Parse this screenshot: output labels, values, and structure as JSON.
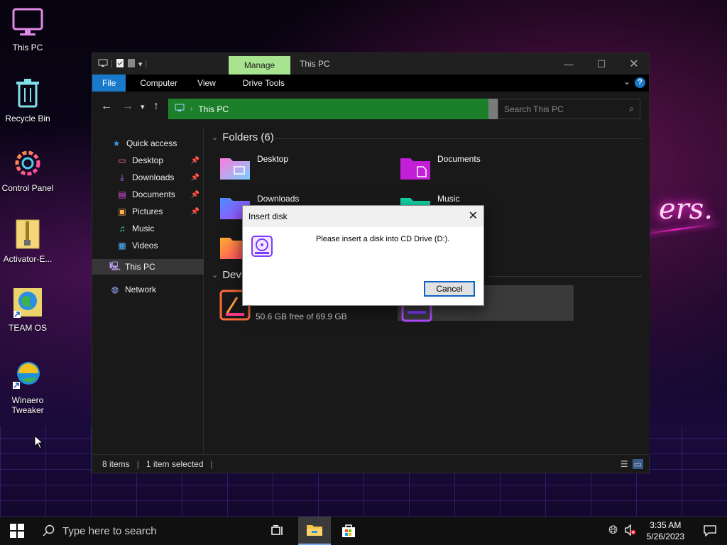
{
  "desktop": {
    "icons": [
      {
        "label": "This PC",
        "icon": "computer-icon"
      },
      {
        "label": "Recycle Bin",
        "icon": "trash-icon"
      },
      {
        "label": "Control Panel",
        "icon": "gear-icon"
      },
      {
        "label": "Activator-E...",
        "icon": "zip-folder-icon"
      },
      {
        "label": "TEAM OS",
        "icon": "globe-shortcut-icon"
      },
      {
        "label": "Winaero Tweaker",
        "line1": "Winaero",
        "line2": "Tweaker",
        "icon": "tweaker-icon"
      }
    ],
    "wallpaper_text": "ers."
  },
  "explorer": {
    "title": "This PC",
    "manage_tab": "Manage",
    "ribbon_tabs": [
      "File",
      "Computer",
      "View",
      "Drive Tools"
    ],
    "address": "This PC",
    "search_placeholder": "Search This PC",
    "nav": {
      "quick_access": "Quick access",
      "items": [
        "Desktop",
        "Downloads",
        "Documents",
        "Pictures",
        "Music",
        "Videos"
      ],
      "this_pc": "This PC",
      "network": "Network"
    },
    "folders_header": "Folders (6)",
    "folders": [
      "Desktop",
      "Documents",
      "Downloads",
      "Music"
    ],
    "devices_header": "Devi",
    "drive_free": "50.6 GB free of 69.9 GB",
    "status": {
      "items": "8 items",
      "selected": "1 item selected"
    },
    "colors": {
      "manage_tab": "#a8e48f",
      "address_bar": "#1c7f2a",
      "file_tab": "#1979ca"
    }
  },
  "dialog": {
    "title": "Insert disk",
    "message": "Please insert a disk into CD Drive (D:).",
    "cancel": "Cancel"
  },
  "taskbar": {
    "search_placeholder": "Type here to search",
    "time": "3:35 AM",
    "date": "5/26/2023"
  }
}
